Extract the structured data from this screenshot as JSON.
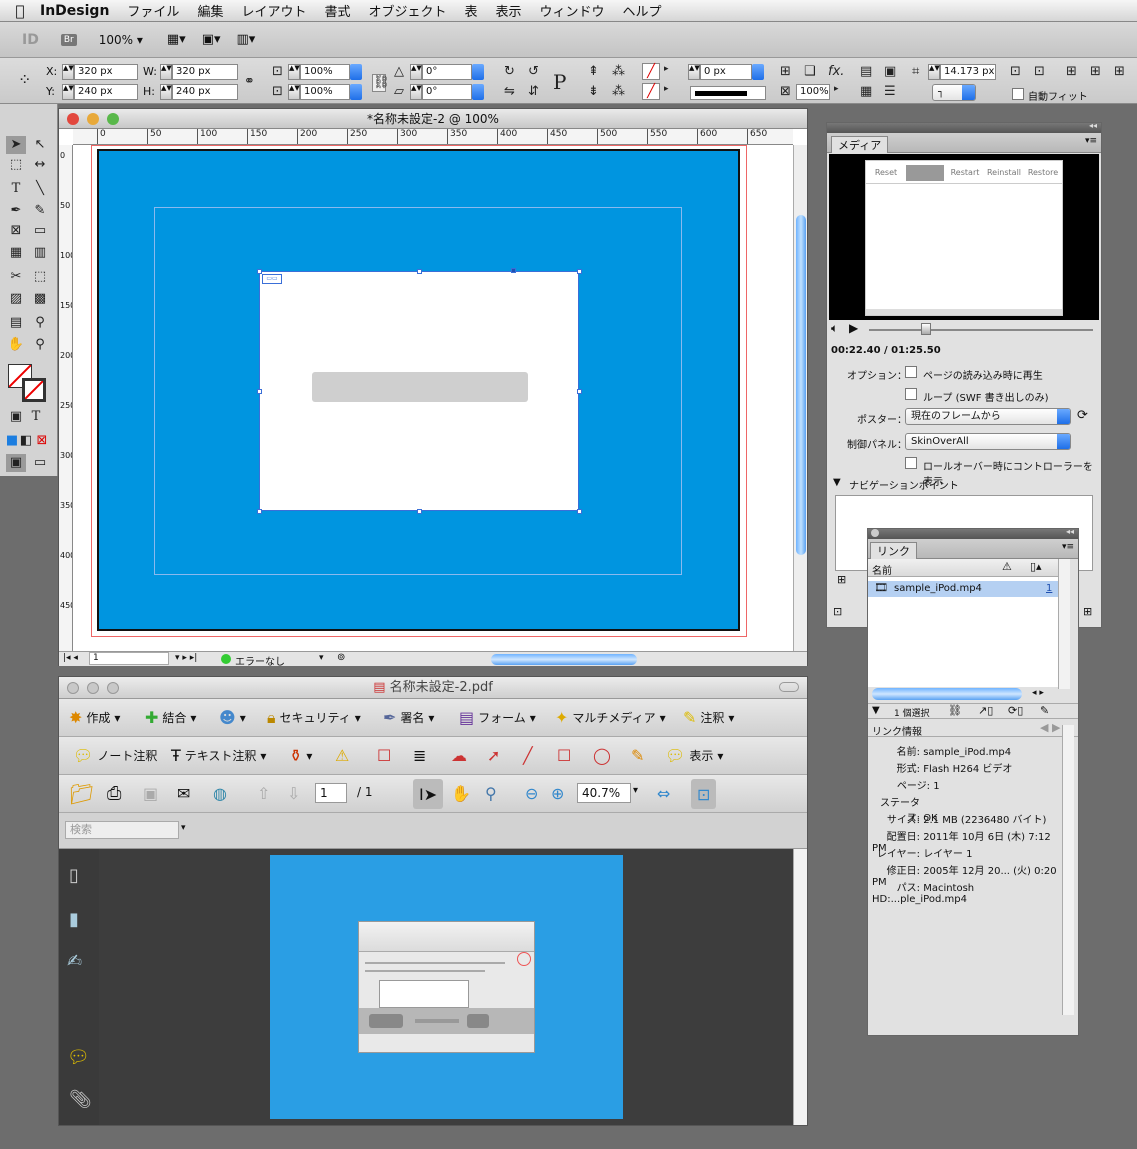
{
  "menubar": {
    "app": "InDesign",
    "items": [
      "ファイル",
      "編集",
      "レイアウト",
      "書式",
      "オブジェクト",
      "表",
      "表示",
      "ウィンドウ",
      "ヘルプ"
    ]
  },
  "appbar": {
    "id_logo": "ID",
    "bridge": "Br",
    "zoom": "100%"
  },
  "control": {
    "x": "320 px",
    "y": "240 px",
    "w": "320 px",
    "h": "240 px",
    "scale_x": "100%",
    "scale_y": "100%",
    "rotate": "0°",
    "shear": "0°",
    "stroke": "0 px",
    "ref": "14.173 px",
    "opacity": "100%",
    "autofit": "自動フィット",
    "x_label": "X:",
    "y_label": "Y:",
    "w_label": "W:",
    "h_label": "H:"
  },
  "doc": {
    "title": "*名称未設定-2 @ 100%",
    "page": "1",
    "status": "エラーなし",
    "ruler": [
      "0",
      "50",
      "100",
      "150",
      "200",
      "250",
      "300",
      "350",
      "400",
      "450",
      "500",
      "550",
      "600",
      "650"
    ],
    "vruler": [
      "0",
      "50",
      "100",
      "150",
      "200",
      "250",
      "300",
      "350",
      "400",
      "450"
    ]
  },
  "acrobat": {
    "title": "名称未設定-2.pdf",
    "tb1": [
      "作成",
      "結合",
      "",
      "セキュリティ",
      "署名",
      "フォーム",
      "マルチメディア",
      "注釈"
    ],
    "tb2": [
      "ノート注釈",
      "テキスト注釈",
      "表示"
    ],
    "page_current": "1",
    "page_total": "/ 1",
    "zoom": "40.7%",
    "search_placeholder": "検索"
  },
  "media": {
    "tab": "メディア",
    "buttons": [
      "Reset",
      "",
      "Restart",
      "Reinstall",
      "Restore"
    ],
    "time": "00:22.40 / 01:25.50",
    "options_label": "オプション：",
    "opt1": "ページの読み込み時に再生",
    "opt2": "ループ (SWF 書き出しのみ)",
    "poster_label": "ポスター：",
    "poster_value": "現在のフレームから",
    "control_label": "制御パネル：",
    "control_value": "SkinOverAll",
    "rollover": "ロールオーバー時にコントローラーを表示",
    "nav": "ナビゲーションポイント"
  },
  "links": {
    "tab": "リンク",
    "col_name": "名前",
    "file": "sample_iPod.mp4",
    "file_page": "1",
    "selected": "1 個選択",
    "info_title": "リンク情報",
    "info": [
      {
        "k": "名前:",
        "v": "sample_iPod.mp4"
      },
      {
        "k": "形式:",
        "v": "Flash H264 ビデオ"
      },
      {
        "k": "ページ:",
        "v": "1"
      },
      {
        "k": "ステータス:",
        "v": "OK"
      },
      {
        "k": "サイズ:",
        "v": "2.1 MB (2236480 バイト)"
      },
      {
        "k": "配置日:",
        "v": "2011年 10月 6日 (木) 7:12 PM"
      },
      {
        "k": "レイヤー:",
        "v": "レイヤー 1"
      },
      {
        "k": "修正日:",
        "v": "2005年 12月 20... (火) 0:20 PM"
      },
      {
        "k": "パス:",
        "v": "Macintosh HD:...ple_iPod.mp4"
      }
    ]
  }
}
